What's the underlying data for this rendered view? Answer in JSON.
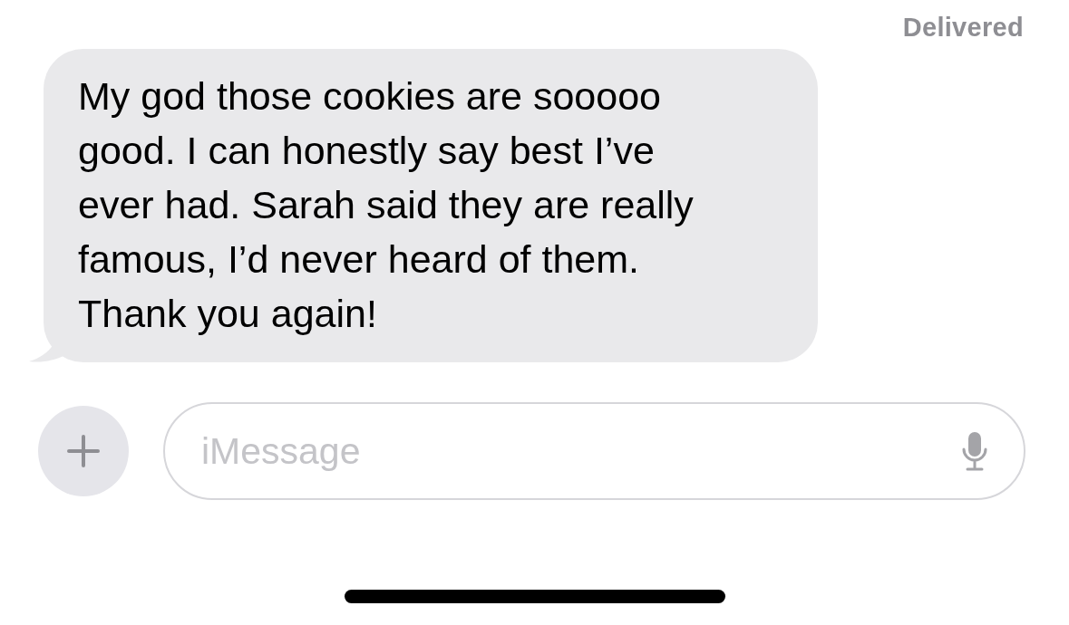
{
  "status": "Delivered",
  "messages": [
    {
      "text": "My god those cookies are sooooo good. I can honestly say best I’ve ever had. Sarah said they are really famous, I’d never heard of them. Thank you again!"
    }
  ],
  "composer": {
    "placeholder": "iMessage"
  }
}
